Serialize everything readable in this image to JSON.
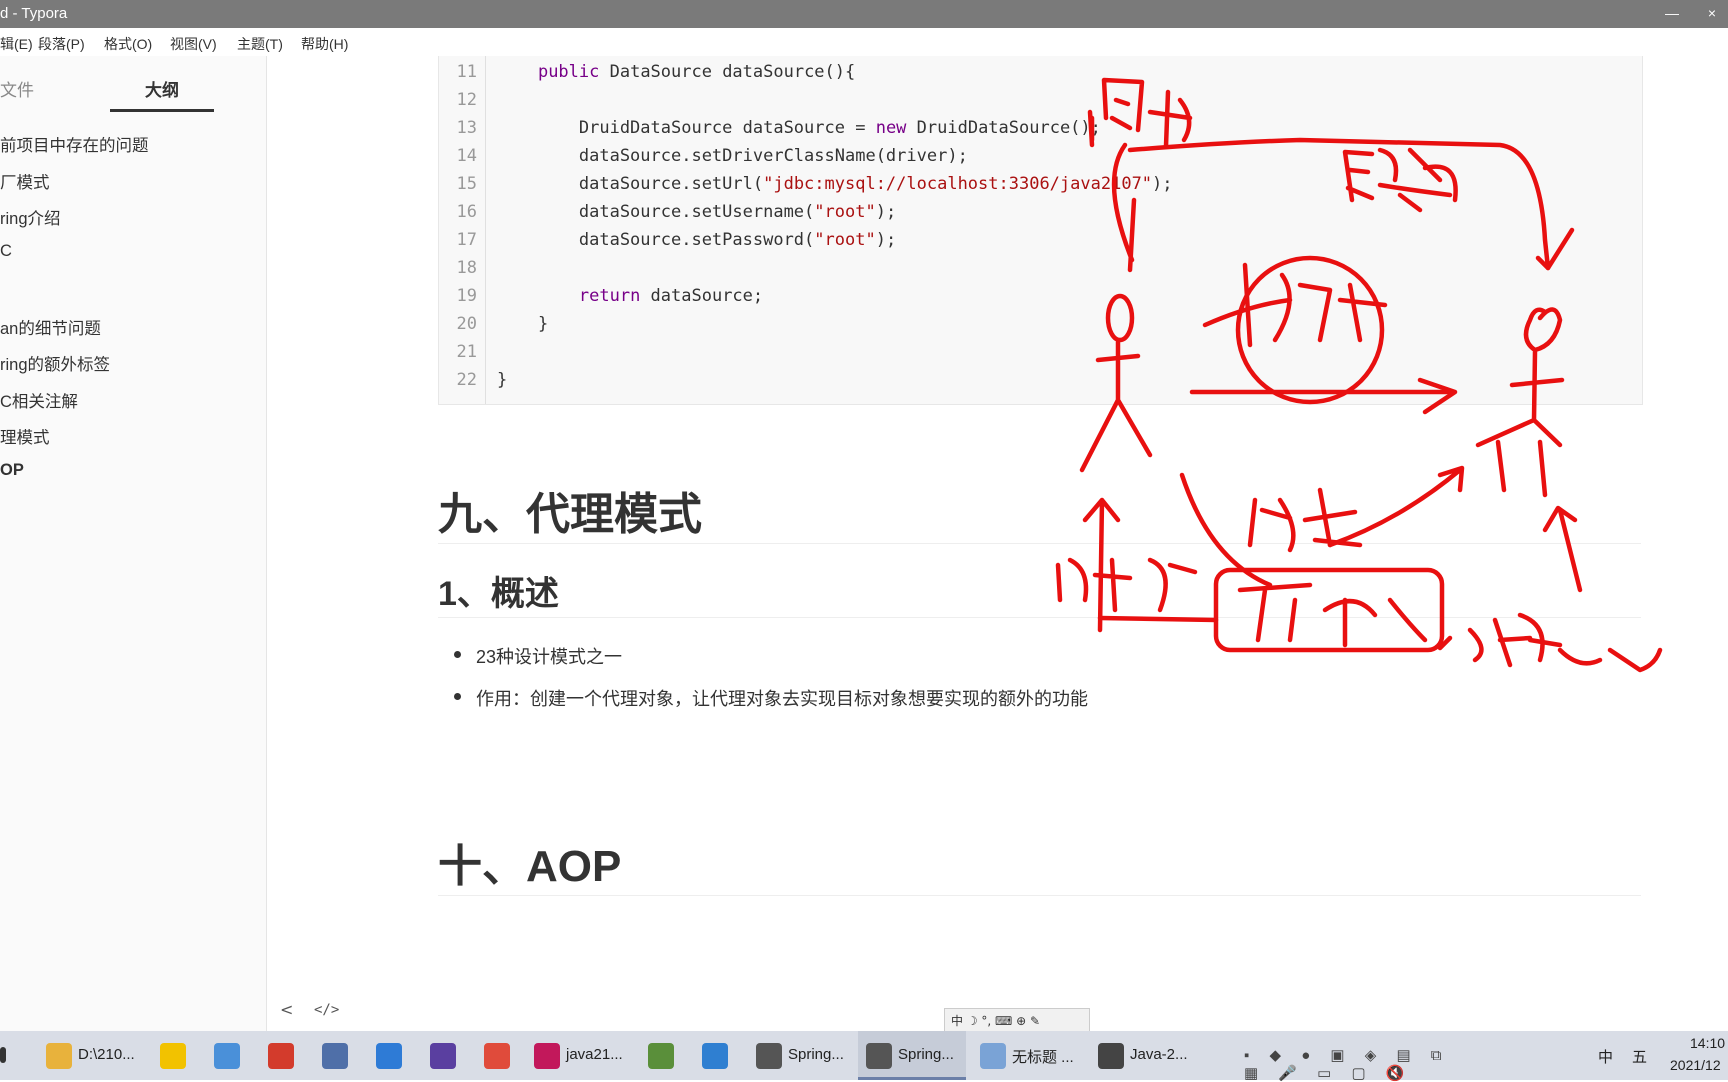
{
  "window": {
    "title": "d - Typora",
    "minimize": "—",
    "close": "×"
  },
  "menu": [
    "辑(E)",
    "段落(P)",
    "格式(O)",
    "视图(V)",
    "主题(T)",
    "帮助(H)"
  ],
  "sidebar": {
    "tab_files": "文件",
    "tab_outline": "大纲",
    "items": [
      {
        "label": "前项目中存在的问题"
      },
      {
        "label": "厂模式"
      },
      {
        "label": "ring介绍"
      },
      {
        "label": "C"
      },
      {
        "label": ""
      },
      {
        "label": "an的细节问题"
      },
      {
        "label": "ring的额外标签"
      },
      {
        "label": "C相关注解"
      },
      {
        "label": "理模式"
      },
      {
        "label": "OP",
        "active": true
      }
    ],
    "footer_back": "<",
    "footer_source": "</>"
  },
  "code": {
    "lines": [
      {
        "n": "11",
        "parts": [
          {
            "t": "    "
          },
          {
            "t": "public",
            "c": "kw"
          },
          {
            "t": " DataSource dataSource(){"
          }
        ]
      },
      {
        "n": "12",
        "parts": [
          {
            "t": ""
          }
        ]
      },
      {
        "n": "13",
        "parts": [
          {
            "t": "        DruidDataSource dataSource = "
          },
          {
            "t": "new",
            "c": "kw"
          },
          {
            "t": " DruidDataSource();"
          }
        ]
      },
      {
        "n": "14",
        "parts": [
          {
            "t": "        dataSource.setDriverClassName(driver);"
          }
        ]
      },
      {
        "n": "15",
        "parts": [
          {
            "t": "        dataSource.setUrl("
          },
          {
            "t": "\"jdbc:mysql://localhost:3306/java2107\"",
            "c": "str"
          },
          {
            "t": ");"
          }
        ]
      },
      {
        "n": "16",
        "parts": [
          {
            "t": "        dataSource.setUsername("
          },
          {
            "t": "\"root\"",
            "c": "str"
          },
          {
            "t": ");"
          }
        ]
      },
      {
        "n": "17",
        "parts": [
          {
            "t": "        dataSource.setPassword("
          },
          {
            "t": "\"root\"",
            "c": "str"
          },
          {
            "t": ");"
          }
        ]
      },
      {
        "n": "18",
        "parts": [
          {
            "t": ""
          }
        ]
      },
      {
        "n": "19",
        "parts": [
          {
            "t": "        "
          },
          {
            "t": "return",
            "c": "kw"
          },
          {
            "t": " dataSource;"
          }
        ]
      },
      {
        "n": "20",
        "parts": [
          {
            "t": "    }"
          }
        ]
      },
      {
        "n": "21",
        "parts": [
          {
            "t": ""
          }
        ]
      },
      {
        "n": "22",
        "parts": [
          {
            "t": "}"
          }
        ]
      }
    ]
  },
  "doc": {
    "h_proxy": "九、代理模式",
    "h_overview": "1、概述",
    "bullets": [
      "23种设计模式之一",
      "作用：创建一个代理对象，让代理对象去实现目标对象想要实现的额外的功能"
    ],
    "h_aop": "十、AOP"
  },
  "ime_bar": "中 ☽ °, ⌨ ⊕ ✎",
  "taskbar": {
    "items": [
      {
        "label": "D:\\210...",
        "color": "#e8b23c"
      },
      {
        "label": "",
        "color": "#f2c200"
      },
      {
        "label": "",
        "color": "#4a90d9"
      },
      {
        "label": "",
        "color": "#d33b2c"
      },
      {
        "label": "",
        "color": "#4f6fa8"
      },
      {
        "label": "",
        "color": "#2e7bd6"
      },
      {
        "label": "",
        "color": "#5a3fa0"
      },
      {
        "label": "",
        "color": "#e04b3b"
      },
      {
        "label": "java21...",
        "color": "#c2185b"
      },
      {
        "label": "",
        "color": "#5a8f3a"
      },
      {
        "label": "",
        "color": "#2f7fd1"
      },
      {
        "label": "Spring...",
        "color": "#555555"
      },
      {
        "label": "Spring...",
        "color": "#555555",
        "active": true
      },
      {
        "label": "无标题 ...",
        "color": "#7aa3d6"
      },
      {
        "label": "Java-2...",
        "color": "#444444"
      }
    ],
    "tray_lang": "中",
    "tray_ime": "五",
    "time": "14:10",
    "date": "2021/12"
  }
}
